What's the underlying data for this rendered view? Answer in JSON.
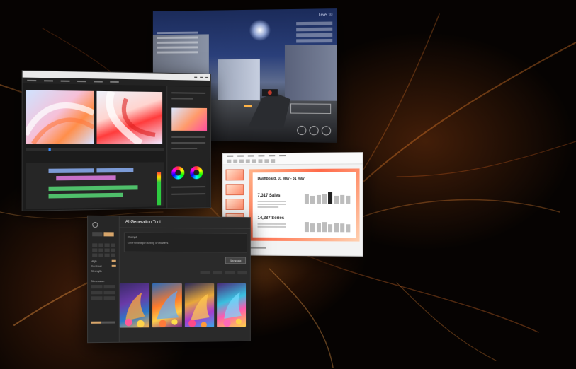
{
  "game": {
    "hud_level": "Level 10"
  },
  "presentation": {
    "slide_title": "Dashboard, 01 May - 31 May",
    "stat_sales": "7,317 Sales",
    "stat_series": "14,287 Series",
    "bars_top": [
      0.55,
      0.45,
      0.5,
      0.55,
      0.65,
      0.45,
      0.5,
      0.45
    ],
    "bars_bottom": [
      0.6,
      0.5,
      0.55,
      0.6,
      0.45,
      0.55,
      0.5,
      0.45
    ]
  },
  "ai_tool": {
    "title": "AI Generation Tool",
    "prompt_label": "Prompt",
    "prompt_text": "colorful dragon sitting on flowers",
    "generate_label": "Generate",
    "option_labels": [
      "High",
      "Contrast",
      "Strength"
    ],
    "dimension_label": "Dimension"
  },
  "colors": {
    "accent": "#d7a56a",
    "glow": "#ff8c28"
  }
}
